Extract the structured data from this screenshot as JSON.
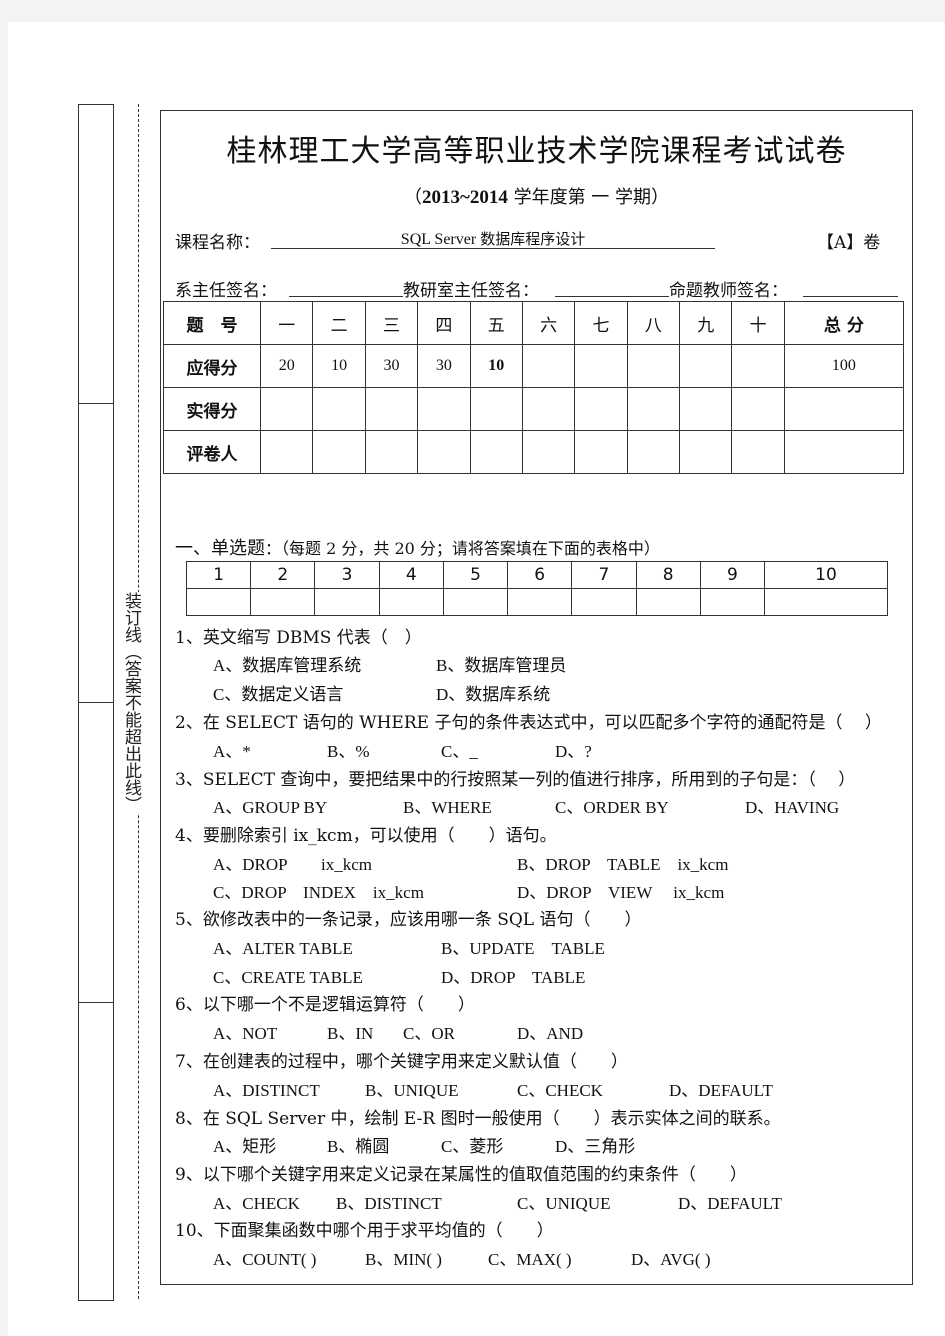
{
  "binding": {
    "text": "装订线（答案不能超出此线）"
  },
  "header": {
    "title": "桂林理工大学高等职业技术学院课程考试试卷",
    "subtitle_open": "（",
    "year": "2013~2014",
    "subtitle_rest": " 学年度第 一 学期）",
    "course_label": "课程名称：",
    "course_name_en": "SQL Server ",
    "course_name_cn": "数据库程序设计",
    "paper_type": "【A】卷",
    "sign_dept_head": "系主任签名：",
    "sign_office_head": "教研室主任签名：",
    "sign_teacher": "命题教师签名："
  },
  "score_table": {
    "row_labels": [
      "题　号",
      "应得分",
      "实得分",
      "评卷人"
    ],
    "columns": [
      "一",
      "二",
      "三",
      "四",
      "五",
      "六",
      "七",
      "八",
      "九",
      "十",
      "总 分"
    ],
    "expected_scores": [
      "20",
      "10",
      "30",
      "30",
      "10",
      "",
      "",
      "",
      "",
      "",
      "100"
    ],
    "actual_scores": [
      "",
      "",
      "",
      "",
      "",
      "",
      "",
      "",
      "",
      "",
      ""
    ],
    "graders": [
      "",
      "",
      "",
      "",
      "",
      "",
      "",
      "",
      "",
      "",
      ""
    ]
  },
  "section1": {
    "title": "一、单选题",
    "note": "：（每题 2 分，共 20 分；请将答案填在下面的表格中）",
    "answer_numbers": [
      "1",
      "2",
      "3",
      "4",
      "5",
      "6",
      "7",
      "8",
      "9",
      "10"
    ],
    "answers": [
      "",
      "",
      "",
      "",
      "",
      "",
      "",
      "",
      "",
      ""
    ],
    "questions": [
      {
        "text": "1、英文缩写 DBMS 代表（　）",
        "options": [
          "A、数据库管理系统",
          "B、数据库管理员",
          "C、数据定义语言",
          "D、数据库系统"
        ]
      },
      {
        "text": "2、在 SELECT 语句的 WHERE 子句的条件表达式中，可以匹配多个字符的通配符是（　 ）",
        "options": [
          "A、*",
          "B、%",
          "C、_",
          "D、?"
        ]
      },
      {
        "text": "3、SELECT 查询中，要把结果中的行按照某一列的值进行排序，所用到的子句是：（　 ）",
        "options": [
          "A、GROUP BY",
          "B、WHERE",
          "C、ORDER BY",
          "D、HAVING"
        ]
      },
      {
        "text": "4、要删除索引 ix_kcm，可以使用（　　）语句。",
        "options": [
          "A、DROP　　ix_kcm",
          "B、DROP　TABLE　ix_kcm",
          "C、DROP　INDEX　ix_kcm",
          "D、DROP　VIEW　 ix_kcm"
        ]
      },
      {
        "text": "5、欲修改表中的一条记录，应该用哪一条 SQL 语句（　　）",
        "options": [
          "A、ALTER TABLE",
          "B、UPDATE　TABLE",
          "C、CREATE TABLE",
          "D、DROP　TABLE"
        ]
      },
      {
        "text": "6、以下哪一个不是逻辑运算符（　　）",
        "options": [
          "A、NOT",
          "B、IN",
          "C、OR",
          "D、AND"
        ]
      },
      {
        "text": "7、在创建表的过程中，哪个关键字用来定义默认值（　　）",
        "options": [
          "A、DISTINCT",
          "B、UNIQUE",
          "C、CHECK",
          "D、DEFAULT"
        ]
      },
      {
        "text": "8、在 SQL Server 中，绘制 E-R 图时一般使用（　　）表示实体之间的联系。",
        "options": [
          "A、矩形",
          "B、椭圆",
          "C、菱形",
          "D、三角形"
        ]
      },
      {
        "text": "9、以下哪个关键字用来定义记录在某属性的值取值范围的约束条件（　　）",
        "options": [
          "A、CHECK",
          "B、DISTINCT",
          "C、UNIQUE",
          "D、DEFAULT"
        ]
      },
      {
        "text": "10、下面聚集函数中哪个用于求平均值的（　　）",
        "options": [
          "A、COUNT( )",
          "B、MIN( )",
          "C、MAX( )",
          "D、AVG( )"
        ]
      }
    ]
  }
}
